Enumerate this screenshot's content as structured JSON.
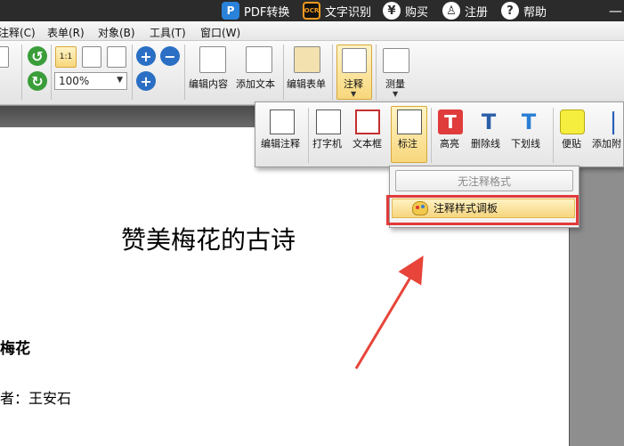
{
  "titlebar": {
    "items": [
      {
        "icon": "pdf-convert-icon",
        "glyph": "P",
        "label": "PDF转换"
      },
      {
        "icon": "ocr-icon",
        "glyph": "OCR",
        "label": "文字识别"
      },
      {
        "icon": "yen-icon",
        "glyph": "¥",
        "label": "购买"
      },
      {
        "icon": "user-icon",
        "glyph": "♙",
        "label": "注册"
      },
      {
        "icon": "help-icon",
        "glyph": "?",
        "label": "帮助"
      }
    ],
    "minimize_glyph": "—"
  },
  "menubar": {
    "items": [
      "注释(C)",
      "表单(R)",
      "对象(B)",
      "工具(T)",
      "窗口(W)"
    ]
  },
  "toolbar": {
    "zoom_value": "100%",
    "buttons": {
      "edit_content": "编辑内容",
      "add_text": "添加文本",
      "edit_form": "编辑表单",
      "annotate": "注释",
      "measure": "测量"
    },
    "actual_size_glyph": "1:1"
  },
  "annot_bar": {
    "buttons": {
      "edit_annot": "编辑注释",
      "typewriter": "打字机",
      "textbox": "文本框",
      "callout": "标注",
      "highlight": "高亮",
      "strikeout": "删除线",
      "underline": "下划线",
      "sticky": "便贴",
      "attach": "添加附"
    },
    "glyphs": {
      "T": "T"
    }
  },
  "dropdown": {
    "no_style": "无注释格式",
    "palette": "注释样式调板"
  },
  "document": {
    "title": "赞美梅花的古诗",
    "poem_title": "梅花",
    "author": "者：王安石"
  },
  "colors": {
    "highlight_box": "#e13b3b",
    "arrow": "#e8443a",
    "pressed_bg": "#f8d77c"
  }
}
